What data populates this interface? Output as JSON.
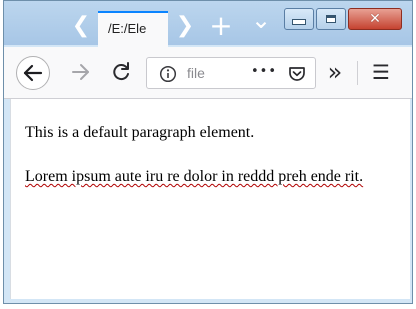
{
  "tabs": {
    "active_title": "/E:/Ele"
  },
  "tabstrip": {
    "scroll_left_glyph": "❮",
    "scroll_right_glyph": "❯",
    "new_tab_glyph": "+",
    "tab_list_glyph": "⌄"
  },
  "window_controls": {
    "minimize": "minimize-icon",
    "maximize": "maximize-icon",
    "close_glyph": "✕"
  },
  "toolbar": {
    "url_text": "file",
    "page_actions_glyph": "•••",
    "overflow_glyph": "»",
    "menu_glyph": "☰"
  },
  "page": {
    "paragraph_1": "This is a default paragraph element.",
    "paragraph_2": "Lorem ipsum aute iru re dolor in reddd preh ende rit."
  },
  "colors": {
    "accent": "#0a84ff",
    "tabstrip": "#a7c6e6",
    "close_button": "#c54331",
    "spellcheck_underline": "#b00000"
  }
}
